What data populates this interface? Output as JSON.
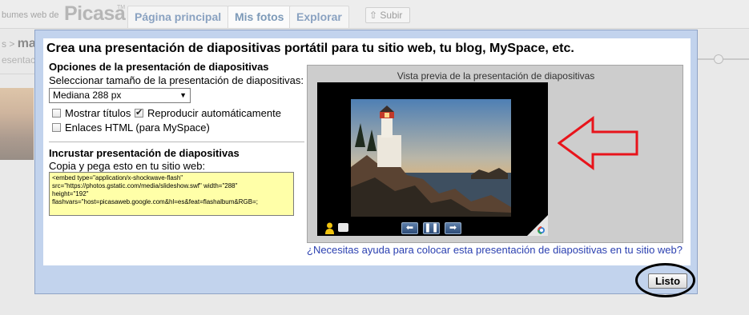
{
  "background": {
    "logo_prefix": "bumes web de",
    "logo_word": "Picasa",
    "logo_tm": "TM",
    "tabs": [
      {
        "label": "Página principal"
      },
      {
        "label": "Mis fotos"
      },
      {
        "label": "Explorar"
      }
    ],
    "upload_label": "Subir",
    "breadcrumb_prefix": "s >",
    "breadcrumb_title": "ma",
    "sub_text": "esentació"
  },
  "dialog": {
    "title": "Crea una presentación de diapositivas portátil para tu sitio web, tu blog, MySpace, etc.",
    "options_title": "Opciones de la presentación de diapositivas",
    "size_label": "Seleccionar tamaño de la presentación de diapositivas:",
    "size_value": "Mediana 288 px",
    "show_titles_label": "Mostrar títulos",
    "show_titles_checked": false,
    "autoplay_label": "Reproducir automáticamente",
    "autoplay_checked": true,
    "html_links_label": "Enlaces HTML (para MySpace)",
    "html_links_checked": false,
    "embed_title": "Incrustar presentación de diapositivas",
    "embed_label": "Copia y pega esto en tu sitio web:",
    "embed_lines": [
      "<embed type=\"application/x-shockwave-flash\"",
      "src=\"https://photos.gstatic.com/media/slideshow.swf\" width=\"288\"",
      "height=\"192\"",
      "flashvars=\"host=picasaweb.google.com&hl=es&feat=flashalbum&RGB=;"
    ],
    "preview_title": "Vista previa de la presentación de diapositivas",
    "help_link": "¿Necesitas ayuda para colocar esta presentación de diapositivas en tu sitio web?",
    "done_label": "Listo"
  },
  "icons": {
    "prev": "left-arrow-icon",
    "pause": "pause-icon",
    "next": "right-arrow-icon"
  },
  "colors": {
    "dialog_frame": "#c2d3ed",
    "embed_bg": "#ffffa8",
    "link": "#2a3fb0",
    "annotation_arrow": "#e8141b"
  }
}
